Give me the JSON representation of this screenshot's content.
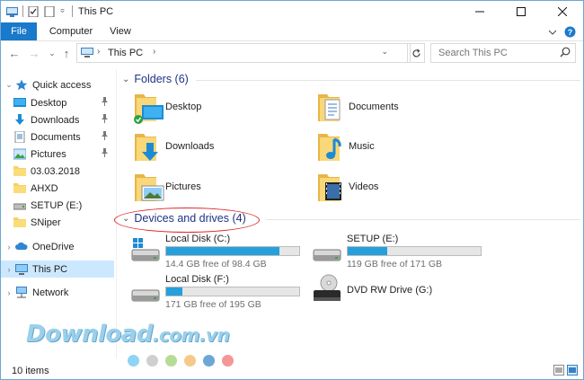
{
  "window": {
    "title": "This PC"
  },
  "ribbon": {
    "tabs": [
      "File",
      "Computer",
      "View"
    ]
  },
  "address": {
    "location": "This PC"
  },
  "search": {
    "placeholder": "Search This PC"
  },
  "sidebar": {
    "quick_access": "Quick access",
    "quick_items": [
      {
        "label": "Desktop",
        "pinned": true
      },
      {
        "label": "Downloads",
        "pinned": true
      },
      {
        "label": "Documents",
        "pinned": true
      },
      {
        "label": "Pictures",
        "pinned": true
      },
      {
        "label": "03.03.2018",
        "pinned": false
      },
      {
        "label": "AHXD",
        "pinned": false
      },
      {
        "label": "SETUP (E:)",
        "pinned": false
      },
      {
        "label": "SNiper",
        "pinned": false
      }
    ],
    "onedrive": "OneDrive",
    "thispc": "This PC",
    "network": "Network"
  },
  "folders": {
    "header": "Folders (6)",
    "items": [
      "Desktop",
      "Documents",
      "Downloads",
      "Music",
      "Pictures",
      "Videos"
    ]
  },
  "devices": {
    "header": "Devices and drives (4)",
    "items": [
      {
        "name": "Local Disk (C:)",
        "free": "14.4 GB free of 98.4 GB",
        "used_fraction": 0.85
      },
      {
        "name": "SETUP (E:)",
        "free": "119 GB free of 171 GB",
        "used_fraction": 0.3
      },
      {
        "name": "Local Disk (F:)",
        "free": "171 GB free of 195 GB",
        "used_fraction": 0.12
      },
      {
        "name": "DVD RW Drive (G:)",
        "free": ""
      }
    ]
  },
  "watermark": {
    "brand": "Download",
    "domain": ".com.vn"
  },
  "dots": [
    "#8fd3f5",
    "#cfcfcf",
    "#b5dc96",
    "#f6c98a",
    "#6ca7d8",
    "#f59797"
  ],
  "status": {
    "count": "10 items"
  },
  "colors": {
    "accent": "#1979ca",
    "bar": "#26a0da",
    "group_header": "#1e3287",
    "highlight": "#e0262a"
  }
}
